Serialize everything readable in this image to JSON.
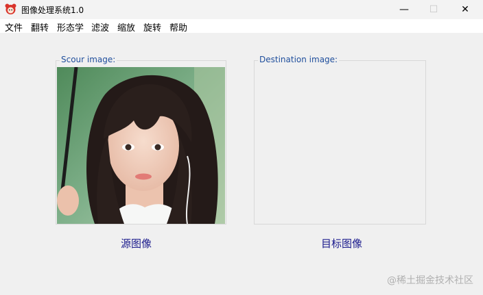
{
  "window": {
    "title": "图像处理系统1.0",
    "minimize_icon": "minimize-icon",
    "maximize_icon": "maximize-icon",
    "close_icon": "close-icon",
    "minimize_glyph": "—",
    "maximize_glyph": "☐",
    "close_glyph": "✕"
  },
  "menu": {
    "items": [
      "文件",
      "翻转",
      "形态学",
      "滤波",
      "缩放",
      "旋转",
      "帮助"
    ]
  },
  "source_panel": {
    "label": "Scour image:",
    "caption": "源图像"
  },
  "destination_panel": {
    "label": "Destination image:",
    "caption": "目标图像"
  },
  "watermark": "@稀土掘金技术社区",
  "colors": {
    "group_label": "#1f4e9c",
    "caption": "#1a1a8c",
    "background": "#f0f0f0"
  }
}
